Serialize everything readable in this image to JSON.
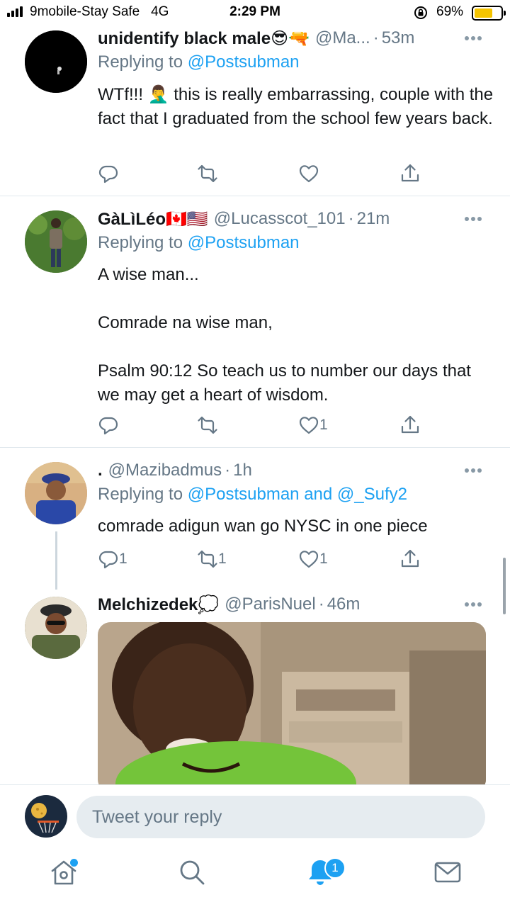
{
  "status_bar": {
    "carrier": "9mobile-Stay Safe",
    "network": "4G",
    "time": "2:29 PM",
    "battery": "69%",
    "battery_level": 0.69
  },
  "tweets": [
    {
      "name": "unidentify black male😎🔫",
      "handle": "@Ma...",
      "time": "53m",
      "replying_prefix": "Replying to ",
      "replying_to": "@Postsubman",
      "body": [
        "WTf!!! 🤦‍♂️ this is really embarrassing, couple with the fact that I graduated from the school few years back."
      ],
      "reply_count": "",
      "retweet_count": "",
      "like_count": ""
    },
    {
      "name": "GàLìLéo🇨🇦🇺🇸",
      "handle": "@Lucasscot_101",
      "time": "21m",
      "replying_prefix": "Replying to ",
      "replying_to": "@Postsubman",
      "body": [
        "A wise man...",
        "",
        "Comrade na wise man,",
        "",
        "Psalm 90:12 So teach us to number our days that we may get a heart of wisdom."
      ],
      "reply_count": "",
      "retweet_count": "",
      "like_count": "1"
    },
    {
      "name": ".",
      "handle": "@Mazibadmus",
      "time": "1h",
      "replying_prefix": "Replying to ",
      "replying_to": "@Postsubman and @_Sufy2",
      "body": [
        "comrade adigun wan go NYSC in one piece"
      ],
      "reply_count": "1",
      "retweet_count": "1",
      "like_count": "1"
    },
    {
      "name": "Melchizedek💭",
      "handle": "@ParisNuel",
      "time": "46m"
    }
  ],
  "compose": {
    "placeholder": "Tweet your reply"
  },
  "tabbar": {
    "notifications_badge": "1"
  },
  "icons": {
    "reply": "reply-icon",
    "retweet": "retweet-icon",
    "like": "heart-icon",
    "share": "share-icon",
    "home": "home-icon",
    "search": "search-icon",
    "notifications": "bell-icon",
    "messages": "mail-icon"
  },
  "colors": {
    "link": "#1da1f2",
    "muted": "#657786",
    "text": "#14171a",
    "divider": "#e1e8ed",
    "battery": "#f5c400"
  }
}
